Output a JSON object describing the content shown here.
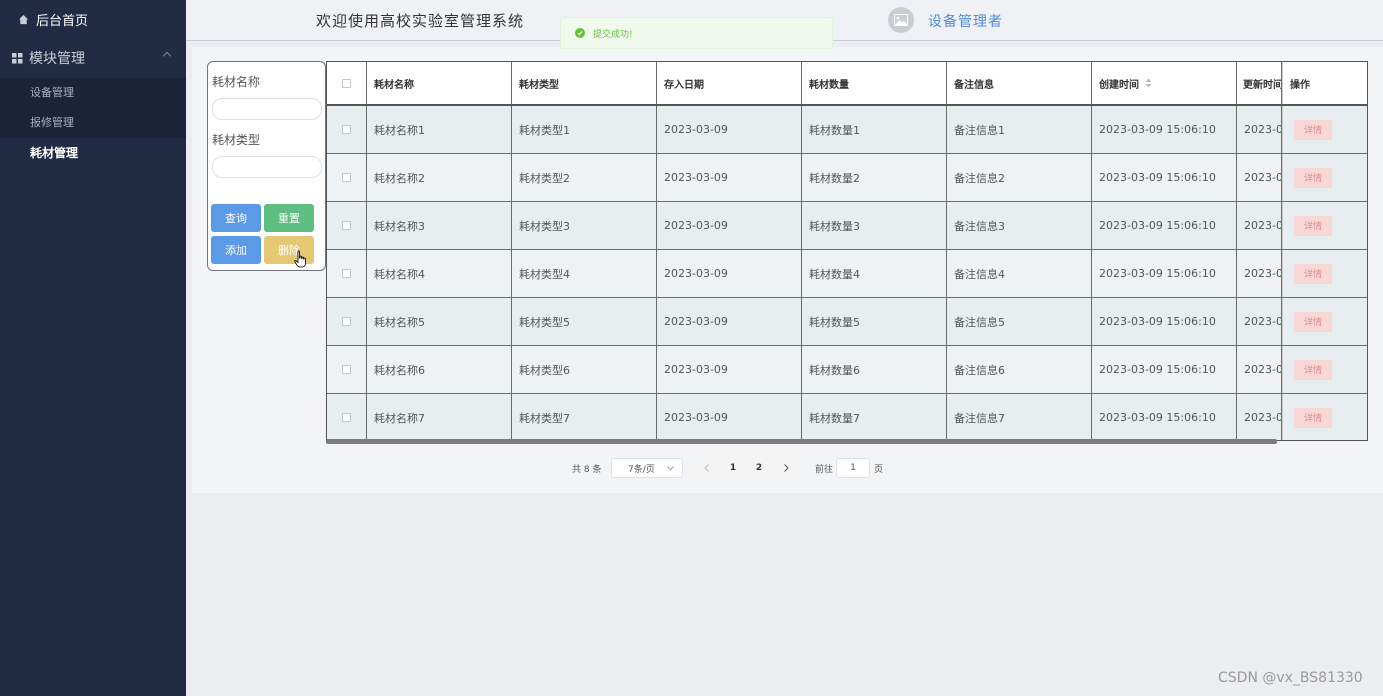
{
  "sidebar": {
    "home": "后台首页",
    "group": "模块管理",
    "items": [
      {
        "label": "设备管理"
      },
      {
        "label": "报修管理"
      },
      {
        "label": "耗材管理"
      }
    ]
  },
  "header": {
    "title": "欢迎使用高校实验室管理系统",
    "username": "设备管理者"
  },
  "toast": {
    "message": "提交成功!"
  },
  "search": {
    "name_label": "耗材名称",
    "name_value": "",
    "type_label": "耗材类型",
    "type_value": "",
    "query_label": "查询",
    "reset_label": "重置",
    "add_label": "添加",
    "delete_label": "删除"
  },
  "table": {
    "columns": [
      "耗材名称",
      "耗材类型",
      "存入日期",
      "耗材数量",
      "备注信息",
      "创建时间",
      "更新时间",
      "操作"
    ],
    "sort_icon": "sort-icon",
    "detail_label": "详情",
    "rows": [
      [
        "耗材名称1",
        "耗材类型1",
        "2023-03-09",
        "耗材数量1",
        "备注信息1",
        "2023-03-09 15:06:10",
        "2023-0"
      ],
      [
        "耗材名称2",
        "耗材类型2",
        "2023-03-09",
        "耗材数量2",
        "备注信息2",
        "2023-03-09 15:06:10",
        "2023-0"
      ],
      [
        "耗材名称3",
        "耗材类型3",
        "2023-03-09",
        "耗材数量3",
        "备注信息3",
        "2023-03-09 15:06:10",
        "2023-0"
      ],
      [
        "耗材名称4",
        "耗材类型4",
        "2023-03-09",
        "耗材数量4",
        "备注信息4",
        "2023-03-09 15:06:10",
        "2023-0"
      ],
      [
        "耗材名称5",
        "耗材类型5",
        "2023-03-09",
        "耗材数量5",
        "备注信息5",
        "2023-03-09 15:06:10",
        "2023-0"
      ],
      [
        "耗材名称6",
        "耗材类型6",
        "2023-03-09",
        "耗材数量6",
        "备注信息6",
        "2023-03-09 15:06:10",
        "2023-0"
      ],
      [
        "耗材名称7",
        "耗材类型7",
        "2023-03-09",
        "耗材数量7",
        "备注信息7",
        "2023-03-09 15:06:10",
        "2023-0"
      ]
    ]
  },
  "pagination": {
    "total": "共 8 条",
    "page_size": "7条/页",
    "pages": [
      "1",
      "2"
    ],
    "goto_prefix": "前往",
    "goto_value": "1",
    "goto_suffix": "页"
  },
  "watermark": "CSDN @vx_BS81330",
  "colors": {
    "sidebar_bg": "#212b43",
    "accent_blue": "#5a9ae6",
    "accent_green": "#5fbe82",
    "accent_yellow": "#e6c773",
    "success": "#67c23a"
  }
}
